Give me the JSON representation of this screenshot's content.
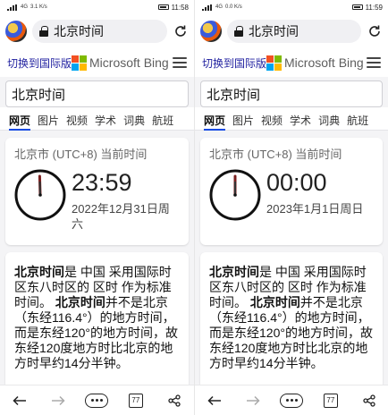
{
  "panes": [
    {
      "status": {
        "left_text": "4G",
        "small_text": "3.1 K/s",
        "time": "11:58"
      },
      "address": "北京时间",
      "bing": {
        "switch_label": "切换到国际版",
        "brand": "Microsoft Bing"
      },
      "search": {
        "value": "北京时间"
      },
      "tabs": [
        "网页",
        "图片",
        "视频",
        "学术",
        "词典",
        "航班"
      ],
      "clock_card": {
        "timezone": "北京市 (UTC+8) 当前时间",
        "time": "23:59",
        "date": "2022年12月31日周六"
      },
      "info": {
        "bold_title": "北京时间",
        "text1": "是 中国 采用国际时区东八时区的 区时 作为标准时间。",
        "bold_title2": "北京时间",
        "text2": "并不是北京（东经116.4°）的地方时间，而是东经120°的地方时间，故东经120度地方时比北京的地方时早约14分半钟。"
      },
      "bottom": {
        "tab_count": "77"
      }
    },
    {
      "status": {
        "left_text": "4G",
        "small_text": "0.0 K/s",
        "time": "11:59"
      },
      "address": "北京时间",
      "bing": {
        "switch_label": "切换到国际版",
        "brand": "Microsoft Bing"
      },
      "search": {
        "value": "北京时间"
      },
      "tabs": [
        "网页",
        "图片",
        "视频",
        "学术",
        "词典",
        "航班"
      ],
      "clock_card": {
        "timezone": "北京市 (UTC+8) 当前时间",
        "time": "00:00",
        "date": "2023年1月1日周日"
      },
      "info": {
        "bold_title": "北京时间",
        "text1": "是 中国 采用国际时区东八时区的 区时 作为标准时间。",
        "bold_title2": "北京时间",
        "text2": "并不是北京（东经116.4°）的地方时间，而是东经120°的地方时间，故东经120度地方时比北京的地方时早约14分半钟。"
      },
      "bottom": {
        "tab_count": "77"
      }
    }
  ],
  "colors": {
    "ms_red": "#f25022",
    "ms_green": "#7fba00",
    "ms_blue": "#00a4ef",
    "ms_yellow": "#ffb900",
    "bing_blue": "#174ae4",
    "link": "#1f1f9f"
  },
  "icons": [
    "lock-icon",
    "reload-icon",
    "menu-icon",
    "mic-icon",
    "search-icon",
    "back-arrow-icon",
    "forward-arrow-icon",
    "more-icon",
    "tabs-icon",
    "share-icon"
  ]
}
